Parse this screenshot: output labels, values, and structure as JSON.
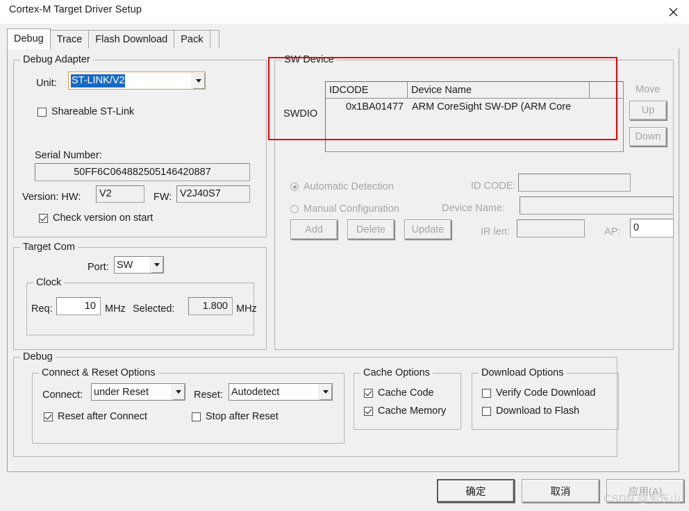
{
  "window": {
    "title": "Cortex-M Target Driver Setup",
    "close_icon": "close-icon"
  },
  "tabs": [
    {
      "label": "Debug",
      "active": true
    },
    {
      "label": "Trace",
      "active": false
    },
    {
      "label": "Flash Download",
      "active": false
    },
    {
      "label": "Pack",
      "active": false
    }
  ],
  "debug_adapter": {
    "legend": "Debug Adapter",
    "unit_label": "Unit:",
    "unit_value": "ST-LINK/V2",
    "shareable_label": "Shareable ST-Link",
    "shareable_checked": false,
    "serial_label": "Serial Number:",
    "serial_value": "50FF6C064882505146420887",
    "version_label": "Version: HW:",
    "hw_value": "V2",
    "fw_label": "FW:",
    "fw_value": "V2J40S7",
    "check_version_label": "Check version on start",
    "check_version_checked": true
  },
  "target_com": {
    "legend": "Target Com",
    "port_label": "Port:",
    "port_value": "SW",
    "clock_legend": "Clock",
    "req_label": "Req:",
    "req_value": "10",
    "req_unit": "MHz",
    "selected_label": "Selected:",
    "selected_value": "1.800",
    "selected_unit": "MHz"
  },
  "sw_device": {
    "legend": "SW Device",
    "swdio_label": "SWDIO",
    "columns": [
      "IDCODE",
      "Device Name",
      ""
    ],
    "rows": [
      {
        "idcode": "0x1BA01477",
        "device_name": "ARM CoreSight SW-DP (ARM Core",
        "extra": ""
      }
    ],
    "move_label": "Move",
    "up_label": "Up",
    "down_label": "Down",
    "auto_detect_label": "Automatic Detection",
    "auto_detect_selected": true,
    "manual_config_label": "Manual Configuration",
    "manual_config_selected": false,
    "id_code_label": "ID CODE:",
    "id_code_value": "",
    "device_name_label": "Device Name:",
    "device_name_value": "",
    "ir_len_label": "IR len:",
    "ir_len_value": "",
    "ap_label": "AP:",
    "ap_value": "0",
    "add_label": "Add",
    "delete_label": "Delete",
    "update_label": "Update"
  },
  "debug_section": {
    "legend": "Debug",
    "connect_reset": {
      "legend": "Connect & Reset Options",
      "connect_label": "Connect:",
      "connect_value": "under Reset",
      "reset_label": "Reset:",
      "reset_value": "Autodetect",
      "reset_after_connect_label": "Reset after Connect",
      "reset_after_connect_checked": true,
      "stop_after_reset_label": "Stop after Reset",
      "stop_after_reset_checked": false
    },
    "cache": {
      "legend": "Cache Options",
      "cache_code_label": "Cache Code",
      "cache_code_checked": true,
      "cache_memory_label": "Cache Memory",
      "cache_memory_checked": true
    },
    "download": {
      "legend": "Download Options",
      "verify_code_label": "Verify Code Download",
      "verify_code_checked": false,
      "download_flash_label": "Download to Flash",
      "download_flash_checked": false
    }
  },
  "footer": {
    "ok_label": "确定",
    "cancel_label": "取消",
    "apply_label": "应用(A)"
  },
  "annotation": {
    "color": "#e60000"
  },
  "watermark": {
    "text": "CSDN @韦东山"
  }
}
